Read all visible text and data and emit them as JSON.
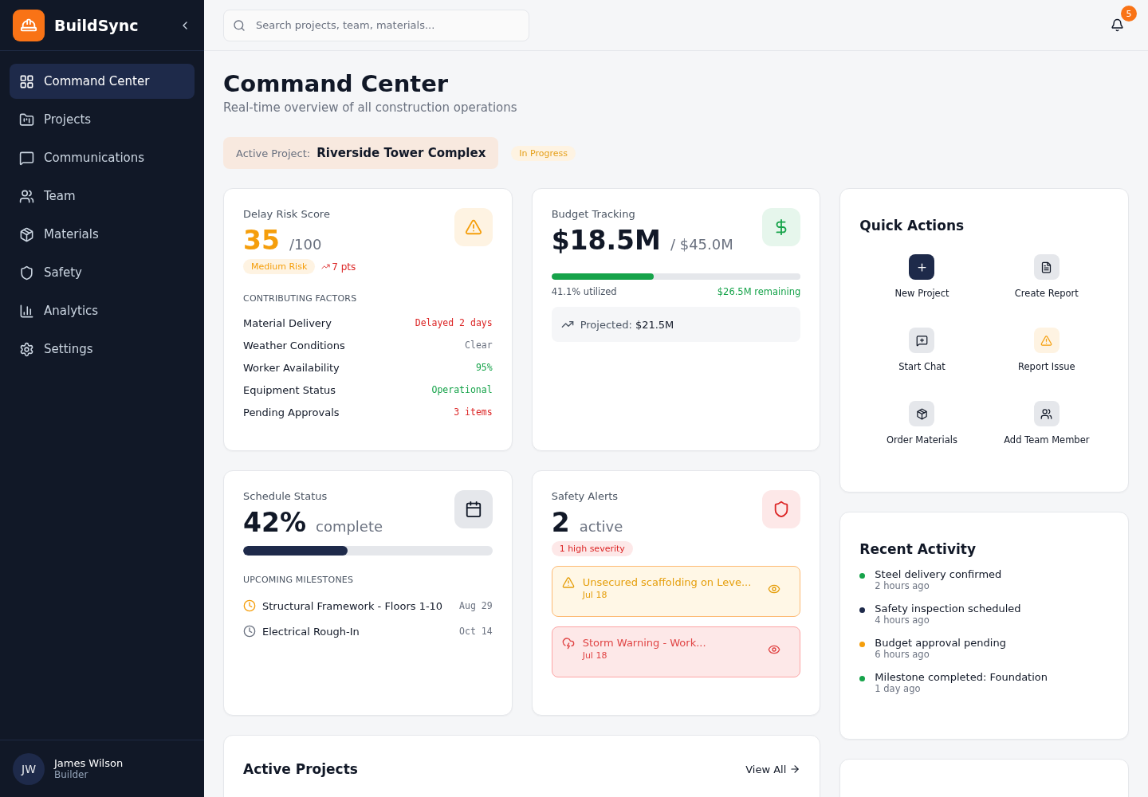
{
  "brand": {
    "name": "BuildSync"
  },
  "nav": [
    {
      "label": "Command Center",
      "selected": true
    },
    {
      "label": "Projects",
      "selected": false
    },
    {
      "label": "Communications",
      "selected": false
    },
    {
      "label": "Team",
      "selected": false
    },
    {
      "label": "Materials",
      "selected": false
    },
    {
      "label": "Safety",
      "selected": false
    },
    {
      "label": "Analytics",
      "selected": false
    },
    {
      "label": "Settings",
      "selected": false
    }
  ],
  "user": {
    "initials": "JW",
    "name": "James Wilson",
    "role": "Builder"
  },
  "search": {
    "placeholder": "Search projects, team, materials..."
  },
  "notifications": {
    "count": "5"
  },
  "page": {
    "title": "Command Center",
    "subtitle": "Real-time overview of all construction operations"
  },
  "active_project": {
    "label": "Active Project:",
    "name": "Riverside Tower Complex",
    "status": "In Progress"
  },
  "delay_risk": {
    "title": "Delay Risk Score",
    "score": "35",
    "max": "/100",
    "badge": "Medium Risk",
    "trend": "7 pts",
    "section": "CONTRIBUTING FACTORS",
    "factors": [
      {
        "name": "Material Delivery",
        "value": "Delayed 2 days",
        "color": "#dc2626"
      },
      {
        "name": "Weather Conditions",
        "value": "Clear",
        "color": "#6b7280"
      },
      {
        "name": "Worker Availability",
        "value": "95%",
        "color": "#16a34a"
      },
      {
        "name": "Equipment Status",
        "value": "Operational",
        "color": "#16a34a"
      },
      {
        "name": "Pending Approvals",
        "value": "3 items",
        "color": "#dc2626"
      }
    ]
  },
  "budget": {
    "title": "Budget Tracking",
    "spent": "$18.5M",
    "total": "/ $45.0M",
    "level": 0.411,
    "utilized": "41.1% utilized",
    "remaining": "$26.5M remaining",
    "projected_label": "Projected:",
    "projected_value": "$21.5M"
  },
  "schedule": {
    "title": "Schedule Status",
    "percent": "42%",
    "suffix": "complete",
    "level": 0.42,
    "section": "UPCOMING MILESTONES",
    "milestones": [
      {
        "name": "Structural Framework - Floors 1-10",
        "date": "Aug 29",
        "color": "#f59e0b"
      },
      {
        "name": "Electrical Rough-In",
        "date": "Oct 14",
        "color": "#6b7280"
      }
    ]
  },
  "safety": {
    "title": "Safety Alerts",
    "count": "2",
    "suffix": "active",
    "badge": "1 high severity",
    "alerts": [
      {
        "kind": "warning",
        "title": "Unsecured scaffolding on Leve...",
        "date": "Jul 18"
      },
      {
        "kind": "storm",
        "title": "Storm Warning - Work...",
        "date": "Jul 18"
      }
    ]
  },
  "active_projects": {
    "title": "Active Projects",
    "link": "View All"
  },
  "quick_actions": {
    "title": "Quick Actions",
    "actions": [
      {
        "label": "New Project",
        "kind": "primary"
      },
      {
        "label": "Create Report",
        "kind": "default"
      },
      {
        "label": "Start Chat",
        "kind": "default"
      },
      {
        "label": "Report Issue",
        "kind": "warning"
      },
      {
        "label": "Order Materials",
        "kind": "default"
      },
      {
        "label": "Add Team Member",
        "kind": "default"
      }
    ]
  },
  "recent_activity": {
    "title": "Recent Activity",
    "items": [
      {
        "text": "Steel delivery confirmed",
        "time": "2 hours ago",
        "color": "#16a34a"
      },
      {
        "text": "Safety inspection scheduled",
        "time": "4 hours ago",
        "color": "#1e2a4a"
      },
      {
        "text": "Budget approval pending",
        "time": "6 hours ago",
        "color": "#f59e0b"
      },
      {
        "text": "Milestone completed: Foundation",
        "time": "1 day ago",
        "color": "#16a34a"
      }
    ]
  }
}
